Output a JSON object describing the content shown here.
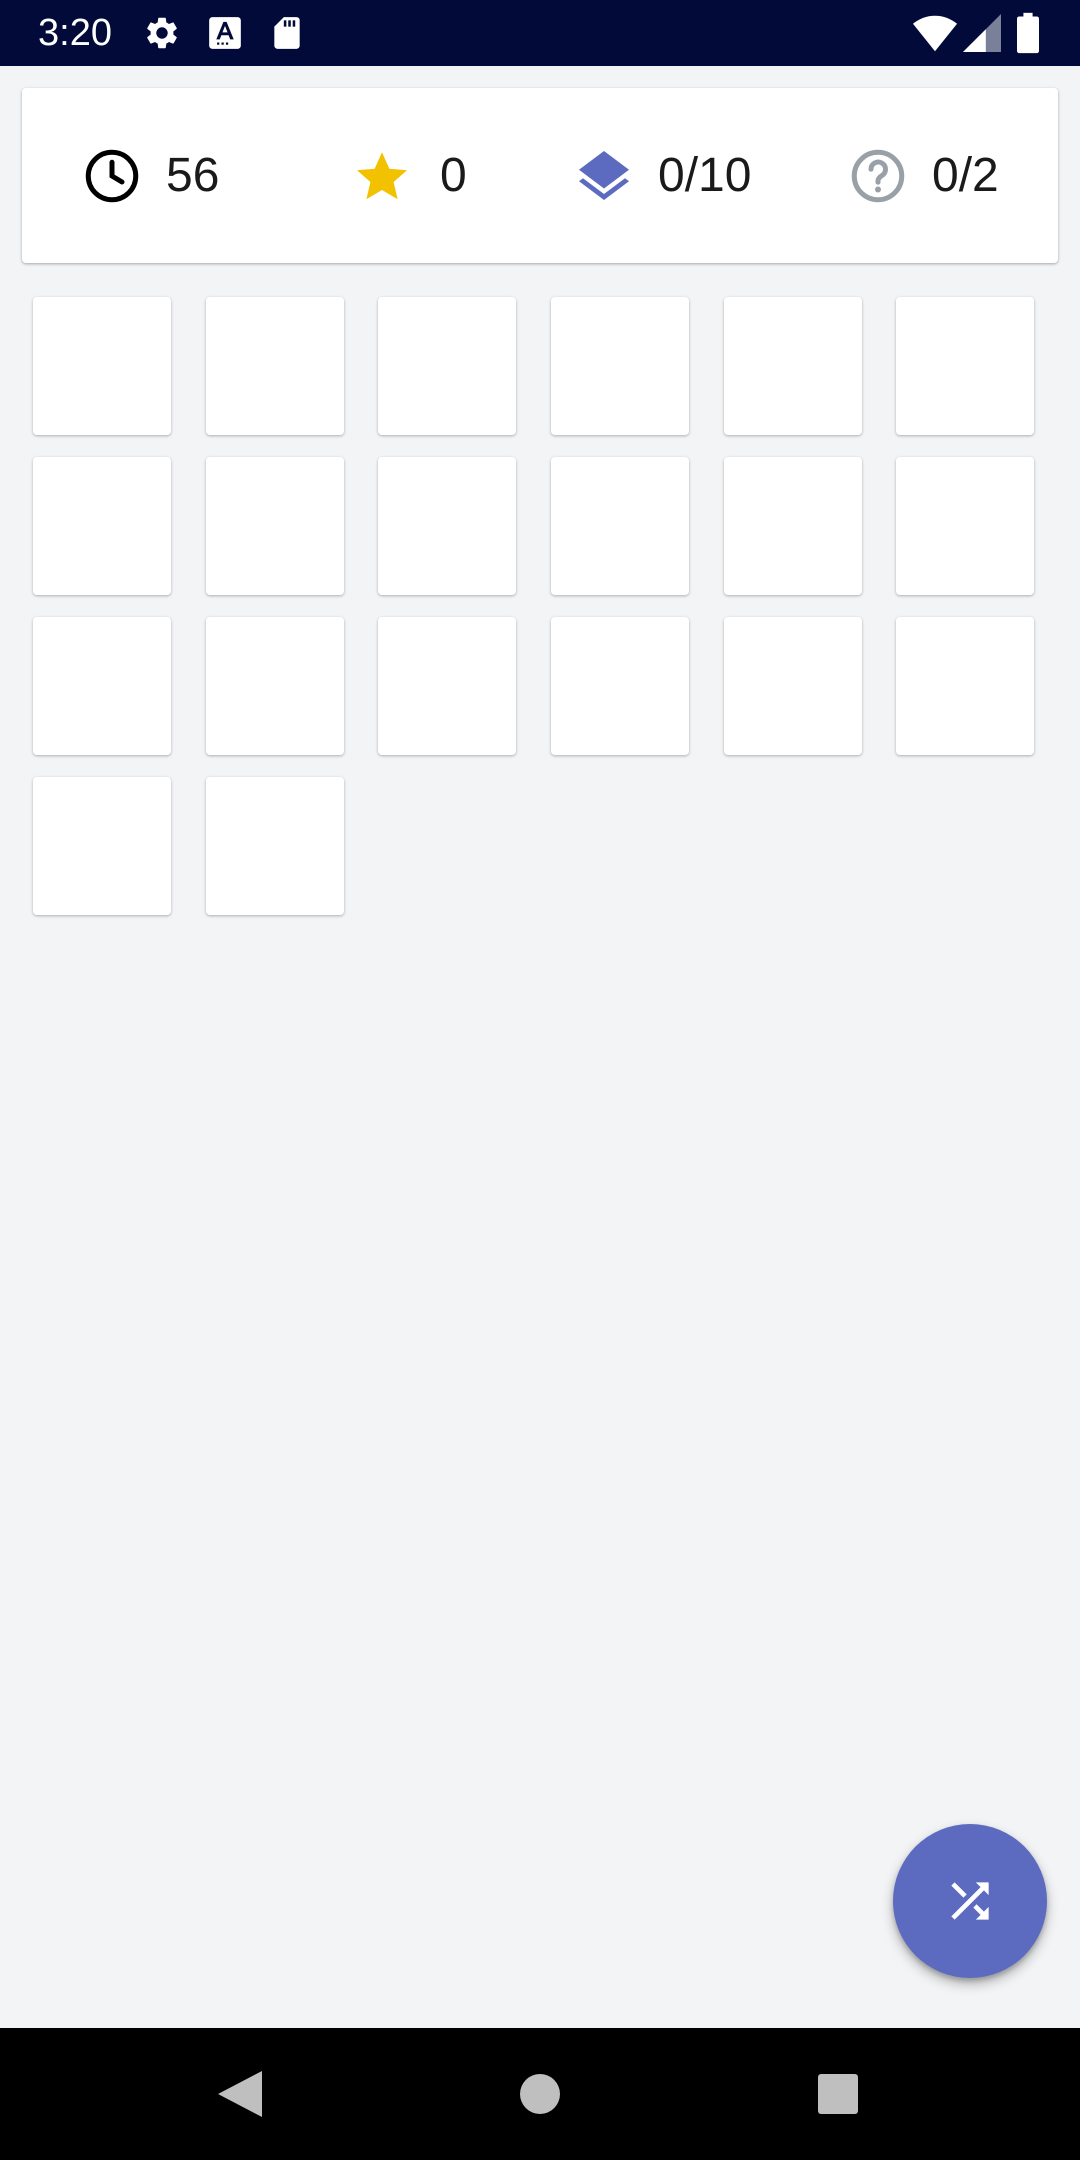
{
  "status_bar": {
    "time": "3:20",
    "icons": [
      "gear-icon",
      "font-a-icon",
      "sd-card-icon",
      "wifi-icon",
      "signal-icon",
      "battery-icon"
    ]
  },
  "stats": {
    "time_remaining": "56",
    "stars": "0",
    "levels": "0/10",
    "hints": "0/2"
  },
  "grid": {
    "tile_count": 20,
    "columns": 6
  },
  "fab": {
    "icon": "shuffle-icon",
    "color": "#5c6bc0"
  },
  "nav_bar": {
    "icons": [
      "back-icon",
      "home-icon",
      "recents-icon"
    ]
  },
  "colors": {
    "status_bar": "#020a3a",
    "background": "#f3f4f6",
    "star": "#f2c200",
    "layers": "#5c6bc0",
    "help": "#9aa0a8"
  }
}
